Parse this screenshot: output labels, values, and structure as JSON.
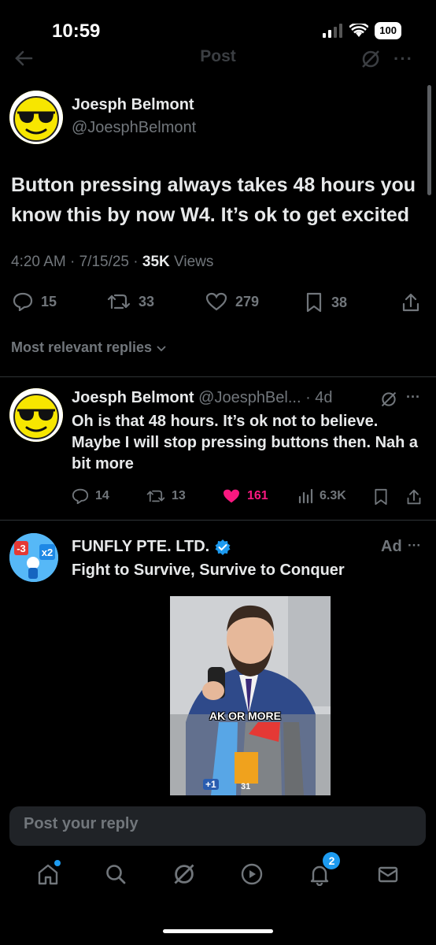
{
  "status": {
    "time": "10:59",
    "battery": "100"
  },
  "header": {
    "title": "Post",
    "more": "···"
  },
  "post": {
    "name": "Joesph Belmont",
    "handle": "@JoesphBelmont",
    "text": "Button pressing always takes 48 hours you know this by now W4. It’s ok to get excited",
    "time": "4:20 AM · 7/15/25 · ",
    "views_count": "35K",
    "views_label": " Views",
    "replies": "15",
    "reposts": "33",
    "likes": "279",
    "bookmarks": "38"
  },
  "sort": {
    "label": "Most relevant replies"
  },
  "reply": {
    "name": "Joesph Belmont",
    "handle": "@JoesphBel...",
    "age": " · 4d",
    "text": "Oh is that 48 hours. It’s ok not to believe. Maybe I will stop pressing buttons then. Nah a bit more",
    "replies": "14",
    "reposts": "13",
    "likes": "161",
    "views": "6.3K",
    "more": "···"
  },
  "ad": {
    "name": "FUNFLY PTE. LTD.",
    "tag": "Ad",
    "more": "···",
    "text": "Fight to Survive, Survive to Conquer",
    "video_caption": "AK OR MORE",
    "game_plus": "+1",
    "game_num": "31"
  },
  "composer": {
    "placeholder": "Post your reply"
  },
  "tabs": {
    "notifications_badge": "2"
  },
  "colors": {
    "accent": "#1d9bf0",
    "like": "#f91880",
    "muted": "#71767b"
  }
}
